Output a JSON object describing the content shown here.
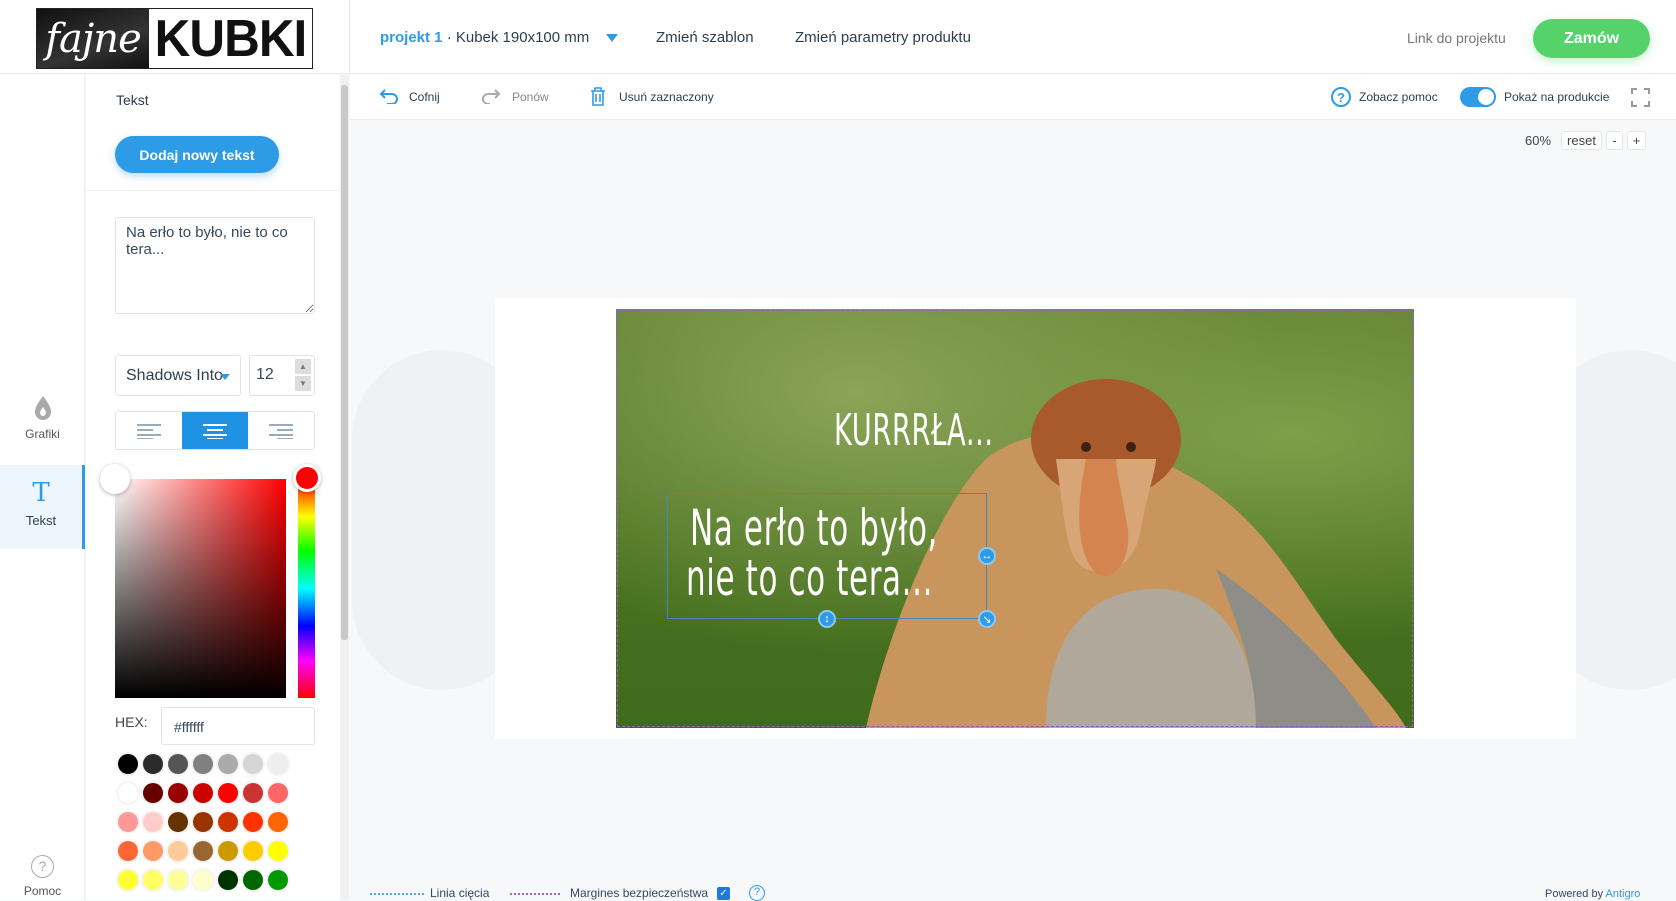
{
  "logo": {
    "script": "fajne",
    "bold": "KUBKI"
  },
  "header": {
    "project": "projekt 1",
    "product": " · Kubek 190x100 mm",
    "change_template": "Zmień szablon",
    "change_params": "Zmień parametry produktu",
    "link": "Link do projektu",
    "order": "Zamów"
  },
  "rail": {
    "items": [
      {
        "label": "Grafiki",
        "icon": "drop-icon"
      },
      {
        "label": "Tekst",
        "icon": "text-icon",
        "active": true
      }
    ],
    "help": "Pomoc"
  },
  "panel": {
    "title": "Tekst",
    "add_button": "Dodaj nowy tekst",
    "text_value": "Na erło to było, nie to co tera...",
    "font": "Shadows Into",
    "size": "12",
    "hex_label": "HEX:",
    "hex_value": "#ffffff",
    "align_active": "center",
    "swatches": [
      "#000000",
      "#2b2b2b",
      "#555555",
      "#808080",
      "#aaaaaa",
      "#d5d5d5",
      "#eeeeee",
      "#ffffff",
      "#660000",
      "#990000",
      "#cc0000",
      "#ff0000",
      "#cc3333",
      "#ff6666",
      "#ff9999",
      "#ffcccc",
      "#663300",
      "#993300",
      "#cc3300",
      "#ff3300",
      "#ff6600",
      "#ff6633",
      "#ff9966",
      "#ffcc99",
      "#996633",
      "#cc9900",
      "#ffcc00",
      "#ffff00",
      "#ffff33",
      "#ffff66",
      "#ffff99",
      "#ffffcc",
      "#003300",
      "#006600",
      "#009900"
    ]
  },
  "toolbar": {
    "undo": "Cofnij",
    "redo": "Ponów",
    "delete": "Usuń zaznaczony",
    "help": "Zobacz pomoc",
    "show_on_product": "Pokaż na produkcie",
    "show_on_product_on": true
  },
  "zoom": {
    "level": "60%",
    "reset": "reset",
    "minus": "-",
    "plus": "+"
  },
  "canvas": {
    "text1": "KURRRŁA...",
    "text2_line1": "Na erło to było,",
    "text2_line2": "nie to co tera..."
  },
  "footer": {
    "cut_line": "Linia cięcia",
    "safety_margin": "Margines bezpieczeństwa",
    "safety_checked": true,
    "powered": "Powered by ",
    "powered_brand": "Antigro"
  },
  "colors": {
    "accent": "#2e9be6",
    "order": "#55d36a"
  }
}
